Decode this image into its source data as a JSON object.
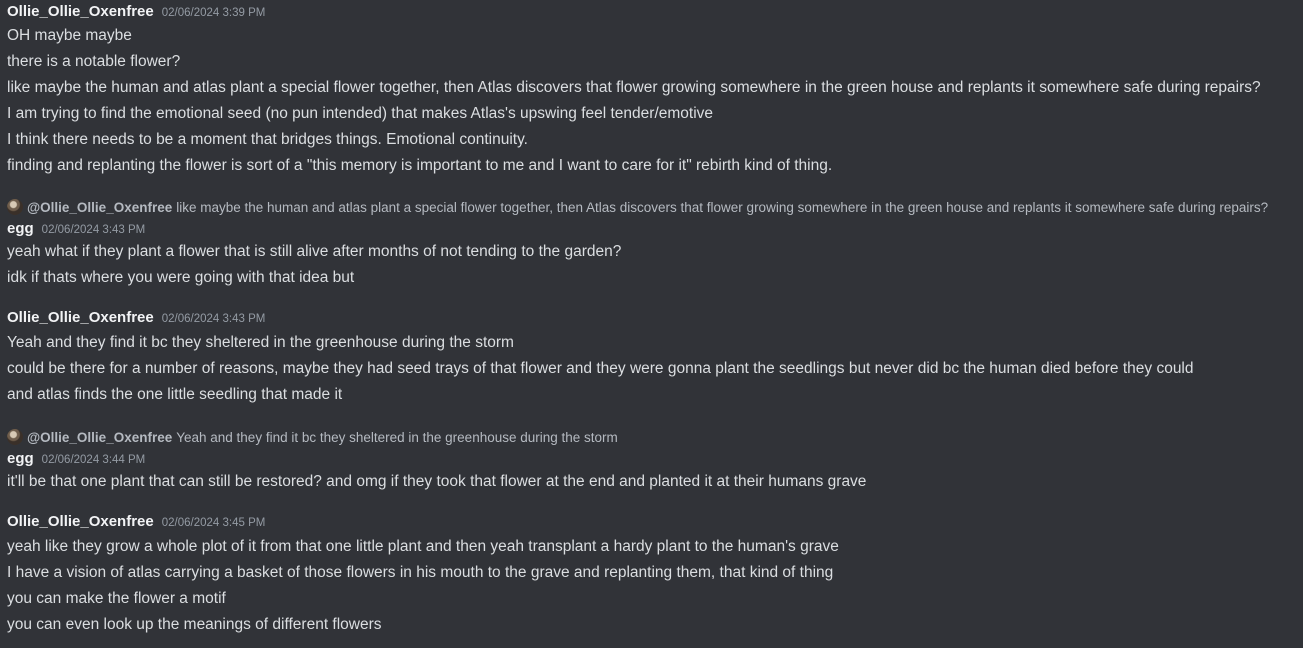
{
  "messages": [
    {
      "username": "Ollie_Ollie_Oxenfree",
      "timestamp": "02/06/2024 3:39 PM",
      "lines": [
        "OH maybe maybe",
        "there is a notable flower?",
        "like maybe the human and atlas plant a special flower together, then Atlas discovers that flower growing somewhere in the green house and replants it somewhere safe during repairs?",
        "I am trying to find the emotional seed (no pun intended) that makes Atlas's upswing feel tender/emotive",
        "I think there needs to be a moment that bridges things. Emotional continuity.",
        "finding and replanting the flower is sort of a \"this memory is important to me and I want to care for it\" rebirth kind of thing."
      ]
    },
    {
      "reply": {
        "mention": "@Ollie_Ollie_Oxenfree",
        "text": "like maybe the human and atlas plant a special flower together, then Atlas discovers that flower growing somewhere in the green house and replants it somewhere safe during repairs?"
      },
      "username": "egg",
      "timestamp": "02/06/2024 3:43 PM",
      "lines": [
        "yeah what if they plant a flower that is still alive after months of not tending to the garden?",
        "idk if thats where you were going with that idea but"
      ]
    },
    {
      "username": "Ollie_Ollie_Oxenfree",
      "timestamp": "02/06/2024 3:43 PM",
      "lines": [
        "Yeah and they find it bc they sheltered in the greenhouse during the storm",
        "could be there for a number of reasons, maybe they had seed trays of that flower and they were gonna plant the seedlings but never did bc the human died before they could",
        "and atlas finds the one little seedling that made it"
      ]
    },
    {
      "reply": {
        "mention": "@Ollie_Ollie_Oxenfree",
        "text": "Yeah and they find it bc they sheltered in the greenhouse during the storm"
      },
      "username": "egg",
      "timestamp": "02/06/2024 3:44 PM",
      "lines": [
        "it'll be that one plant that can still be restored? and omg if they took that flower at the end and planted it at their humans grave"
      ]
    },
    {
      "username": "Ollie_Ollie_Oxenfree",
      "timestamp": "02/06/2024 3:45 PM",
      "lines": [
        "yeah like they grow a whole plot of it from that one little plant and then yeah transplant a hardy plant to the human's grave",
        "I have a vision of atlas carrying a basket of those flowers in his mouth to the grave and replanting them, that kind of thing",
        "you can make the flower a motif",
        "you can even look up the meanings of different flowers"
      ]
    }
  ]
}
